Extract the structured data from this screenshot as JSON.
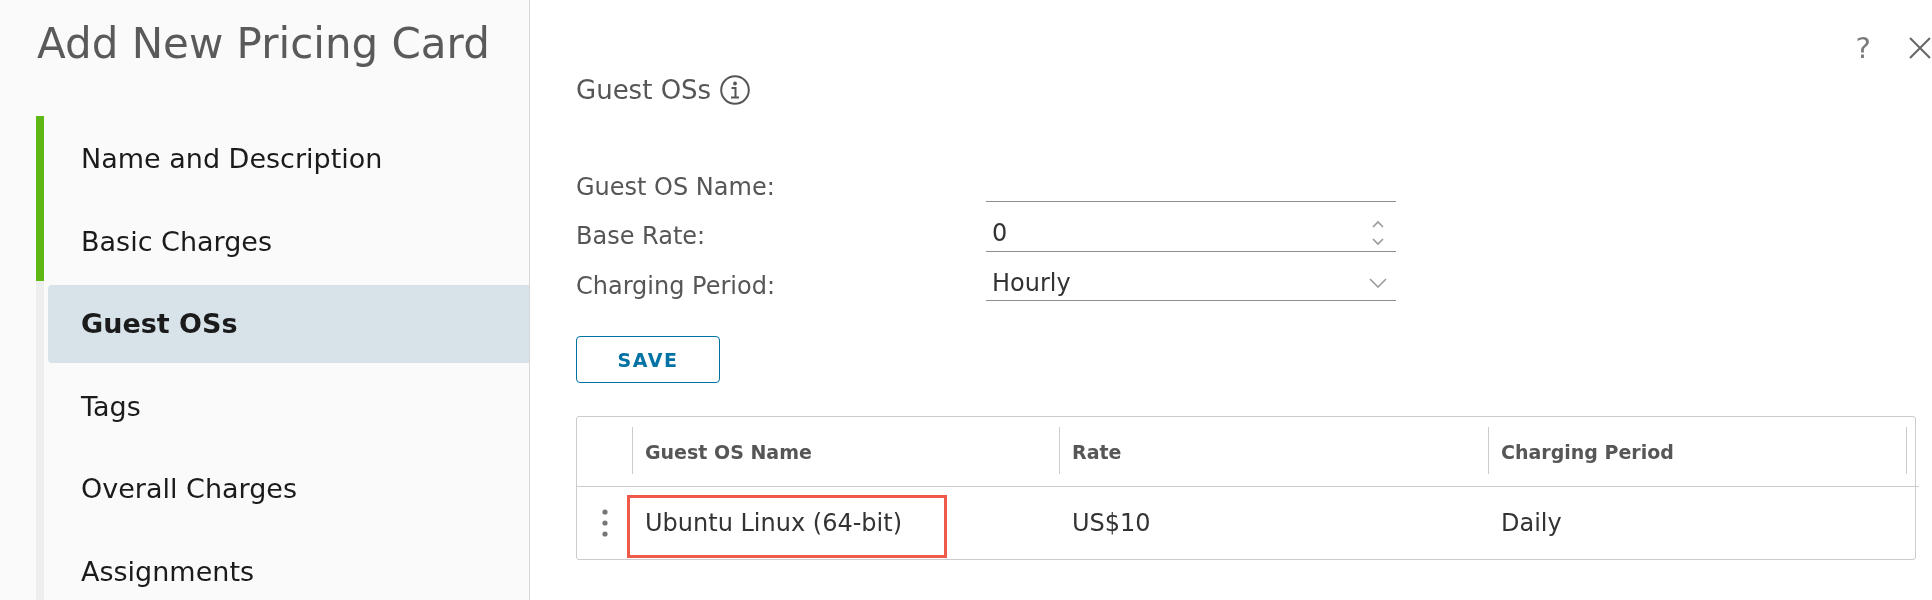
{
  "dialog": {
    "title": "Add New Pricing Card",
    "help": "?"
  },
  "steps": [
    {
      "label": "Name and Description",
      "completed": true,
      "selected": false
    },
    {
      "label": "Basic Charges",
      "completed": true,
      "selected": false
    },
    {
      "label": "Guest OSs",
      "completed": false,
      "selected": true
    },
    {
      "label": "Tags",
      "completed": false,
      "selected": false
    },
    {
      "label": "Overall Charges",
      "completed": false,
      "selected": false
    },
    {
      "label": "Assignments",
      "completed": false,
      "selected": false
    }
  ],
  "section": {
    "title": "Guest OSs"
  },
  "form": {
    "fields": [
      {
        "kind": "text",
        "label": "Guest OS Name:"
      },
      {
        "kind": "number",
        "label": "Base Rate:",
        "value": "0"
      },
      {
        "kind": "select",
        "label": "Charging Period:",
        "value": "Hourly"
      }
    ],
    "save_button": "SAVE"
  },
  "table": {
    "columns": [
      "Guest OS Name",
      "Rate",
      "Charging Period"
    ],
    "rows": [
      {
        "cells": [
          "Ubuntu Linux (64-bit)",
          "US$10",
          "Daily"
        ],
        "highlighted": true
      }
    ]
  }
}
